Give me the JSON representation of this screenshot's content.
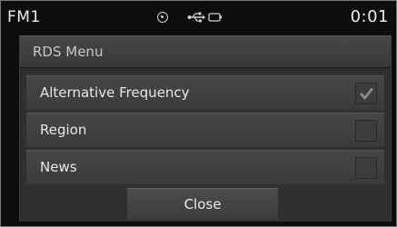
{
  "status_bar": {
    "band": "FM1",
    "time": "0:01",
    "icons": [
      "disc-icon",
      "usb-icon",
      "battery-icon"
    ]
  },
  "dialog": {
    "title": "RDS Menu",
    "items": [
      {
        "label": "Alternative Frequency",
        "checked": true
      },
      {
        "label": "Region",
        "checked": false
      },
      {
        "label": "News",
        "checked": false
      }
    ],
    "close_label": "Close"
  },
  "colors": {
    "background": "#0d0d0d",
    "dialog": "#2f2f2f",
    "text": "#ececec"
  }
}
